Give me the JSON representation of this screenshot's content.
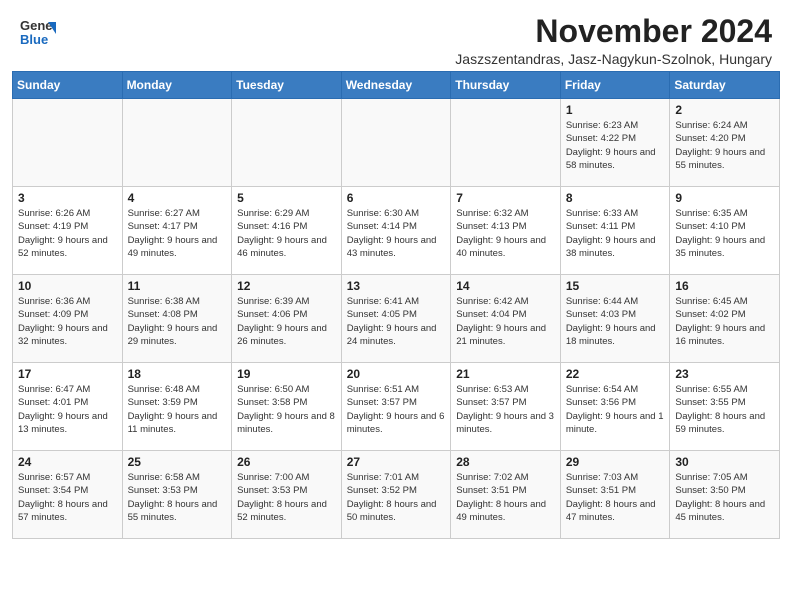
{
  "header": {
    "logo_line1": "General",
    "logo_line2": "Blue",
    "month": "November 2024",
    "location": "Jaszszentandras, Jasz-Nagykun-Szolnok, Hungary"
  },
  "days_of_week": [
    "Sunday",
    "Monday",
    "Tuesday",
    "Wednesday",
    "Thursday",
    "Friday",
    "Saturday"
  ],
  "weeks": [
    [
      {
        "day": "",
        "info": ""
      },
      {
        "day": "",
        "info": ""
      },
      {
        "day": "",
        "info": ""
      },
      {
        "day": "",
        "info": ""
      },
      {
        "day": "",
        "info": ""
      },
      {
        "day": "1",
        "info": "Sunrise: 6:23 AM\nSunset: 4:22 PM\nDaylight: 9 hours and 58 minutes."
      },
      {
        "day": "2",
        "info": "Sunrise: 6:24 AM\nSunset: 4:20 PM\nDaylight: 9 hours and 55 minutes."
      }
    ],
    [
      {
        "day": "3",
        "info": "Sunrise: 6:26 AM\nSunset: 4:19 PM\nDaylight: 9 hours and 52 minutes."
      },
      {
        "day": "4",
        "info": "Sunrise: 6:27 AM\nSunset: 4:17 PM\nDaylight: 9 hours and 49 minutes."
      },
      {
        "day": "5",
        "info": "Sunrise: 6:29 AM\nSunset: 4:16 PM\nDaylight: 9 hours and 46 minutes."
      },
      {
        "day": "6",
        "info": "Sunrise: 6:30 AM\nSunset: 4:14 PM\nDaylight: 9 hours and 43 minutes."
      },
      {
        "day": "7",
        "info": "Sunrise: 6:32 AM\nSunset: 4:13 PM\nDaylight: 9 hours and 40 minutes."
      },
      {
        "day": "8",
        "info": "Sunrise: 6:33 AM\nSunset: 4:11 PM\nDaylight: 9 hours and 38 minutes."
      },
      {
        "day": "9",
        "info": "Sunrise: 6:35 AM\nSunset: 4:10 PM\nDaylight: 9 hours and 35 minutes."
      }
    ],
    [
      {
        "day": "10",
        "info": "Sunrise: 6:36 AM\nSunset: 4:09 PM\nDaylight: 9 hours and 32 minutes."
      },
      {
        "day": "11",
        "info": "Sunrise: 6:38 AM\nSunset: 4:08 PM\nDaylight: 9 hours and 29 minutes."
      },
      {
        "day": "12",
        "info": "Sunrise: 6:39 AM\nSunset: 4:06 PM\nDaylight: 9 hours and 26 minutes."
      },
      {
        "day": "13",
        "info": "Sunrise: 6:41 AM\nSunset: 4:05 PM\nDaylight: 9 hours and 24 minutes."
      },
      {
        "day": "14",
        "info": "Sunrise: 6:42 AM\nSunset: 4:04 PM\nDaylight: 9 hours and 21 minutes."
      },
      {
        "day": "15",
        "info": "Sunrise: 6:44 AM\nSunset: 4:03 PM\nDaylight: 9 hours and 18 minutes."
      },
      {
        "day": "16",
        "info": "Sunrise: 6:45 AM\nSunset: 4:02 PM\nDaylight: 9 hours and 16 minutes."
      }
    ],
    [
      {
        "day": "17",
        "info": "Sunrise: 6:47 AM\nSunset: 4:01 PM\nDaylight: 9 hours and 13 minutes."
      },
      {
        "day": "18",
        "info": "Sunrise: 6:48 AM\nSunset: 3:59 PM\nDaylight: 9 hours and 11 minutes."
      },
      {
        "day": "19",
        "info": "Sunrise: 6:50 AM\nSunset: 3:58 PM\nDaylight: 9 hours and 8 minutes."
      },
      {
        "day": "20",
        "info": "Sunrise: 6:51 AM\nSunset: 3:57 PM\nDaylight: 9 hours and 6 minutes."
      },
      {
        "day": "21",
        "info": "Sunrise: 6:53 AM\nSunset: 3:57 PM\nDaylight: 9 hours and 3 minutes."
      },
      {
        "day": "22",
        "info": "Sunrise: 6:54 AM\nSunset: 3:56 PM\nDaylight: 9 hours and 1 minute."
      },
      {
        "day": "23",
        "info": "Sunrise: 6:55 AM\nSunset: 3:55 PM\nDaylight: 8 hours and 59 minutes."
      }
    ],
    [
      {
        "day": "24",
        "info": "Sunrise: 6:57 AM\nSunset: 3:54 PM\nDaylight: 8 hours and 57 minutes."
      },
      {
        "day": "25",
        "info": "Sunrise: 6:58 AM\nSunset: 3:53 PM\nDaylight: 8 hours and 55 minutes."
      },
      {
        "day": "26",
        "info": "Sunrise: 7:00 AM\nSunset: 3:53 PM\nDaylight: 8 hours and 52 minutes."
      },
      {
        "day": "27",
        "info": "Sunrise: 7:01 AM\nSunset: 3:52 PM\nDaylight: 8 hours and 50 minutes."
      },
      {
        "day": "28",
        "info": "Sunrise: 7:02 AM\nSunset: 3:51 PM\nDaylight: 8 hours and 49 minutes."
      },
      {
        "day": "29",
        "info": "Sunrise: 7:03 AM\nSunset: 3:51 PM\nDaylight: 8 hours and 47 minutes."
      },
      {
        "day": "30",
        "info": "Sunrise: 7:05 AM\nSunset: 3:50 PM\nDaylight: 8 hours and 45 minutes."
      }
    ]
  ]
}
